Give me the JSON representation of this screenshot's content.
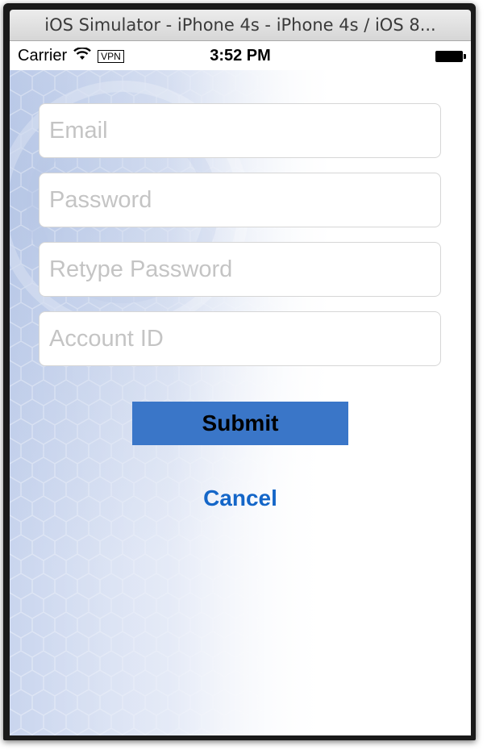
{
  "window": {
    "title": "iOS Simulator - iPhone 4s - iPhone 4s / iOS 8..."
  },
  "status_bar": {
    "carrier": "Carrier",
    "wifi_icon": "wifi-icon",
    "vpn": "VPN",
    "time": "3:52 PM",
    "battery_icon": "battery-icon",
    "battery_level": 1.0
  },
  "form": {
    "email_placeholder": "Email",
    "email_value": "",
    "password_placeholder": "Password",
    "password_value": "",
    "retype_password_placeholder": "Retype Password",
    "retype_password_value": "",
    "account_id_placeholder": "Account ID",
    "account_id_value": ""
  },
  "actions": {
    "submit_label": "Submit",
    "cancel_label": "Cancel"
  },
  "colors": {
    "submit_background": "#3a76c8",
    "cancel_text": "#1466c8",
    "placeholder": "#c4c4c4"
  }
}
